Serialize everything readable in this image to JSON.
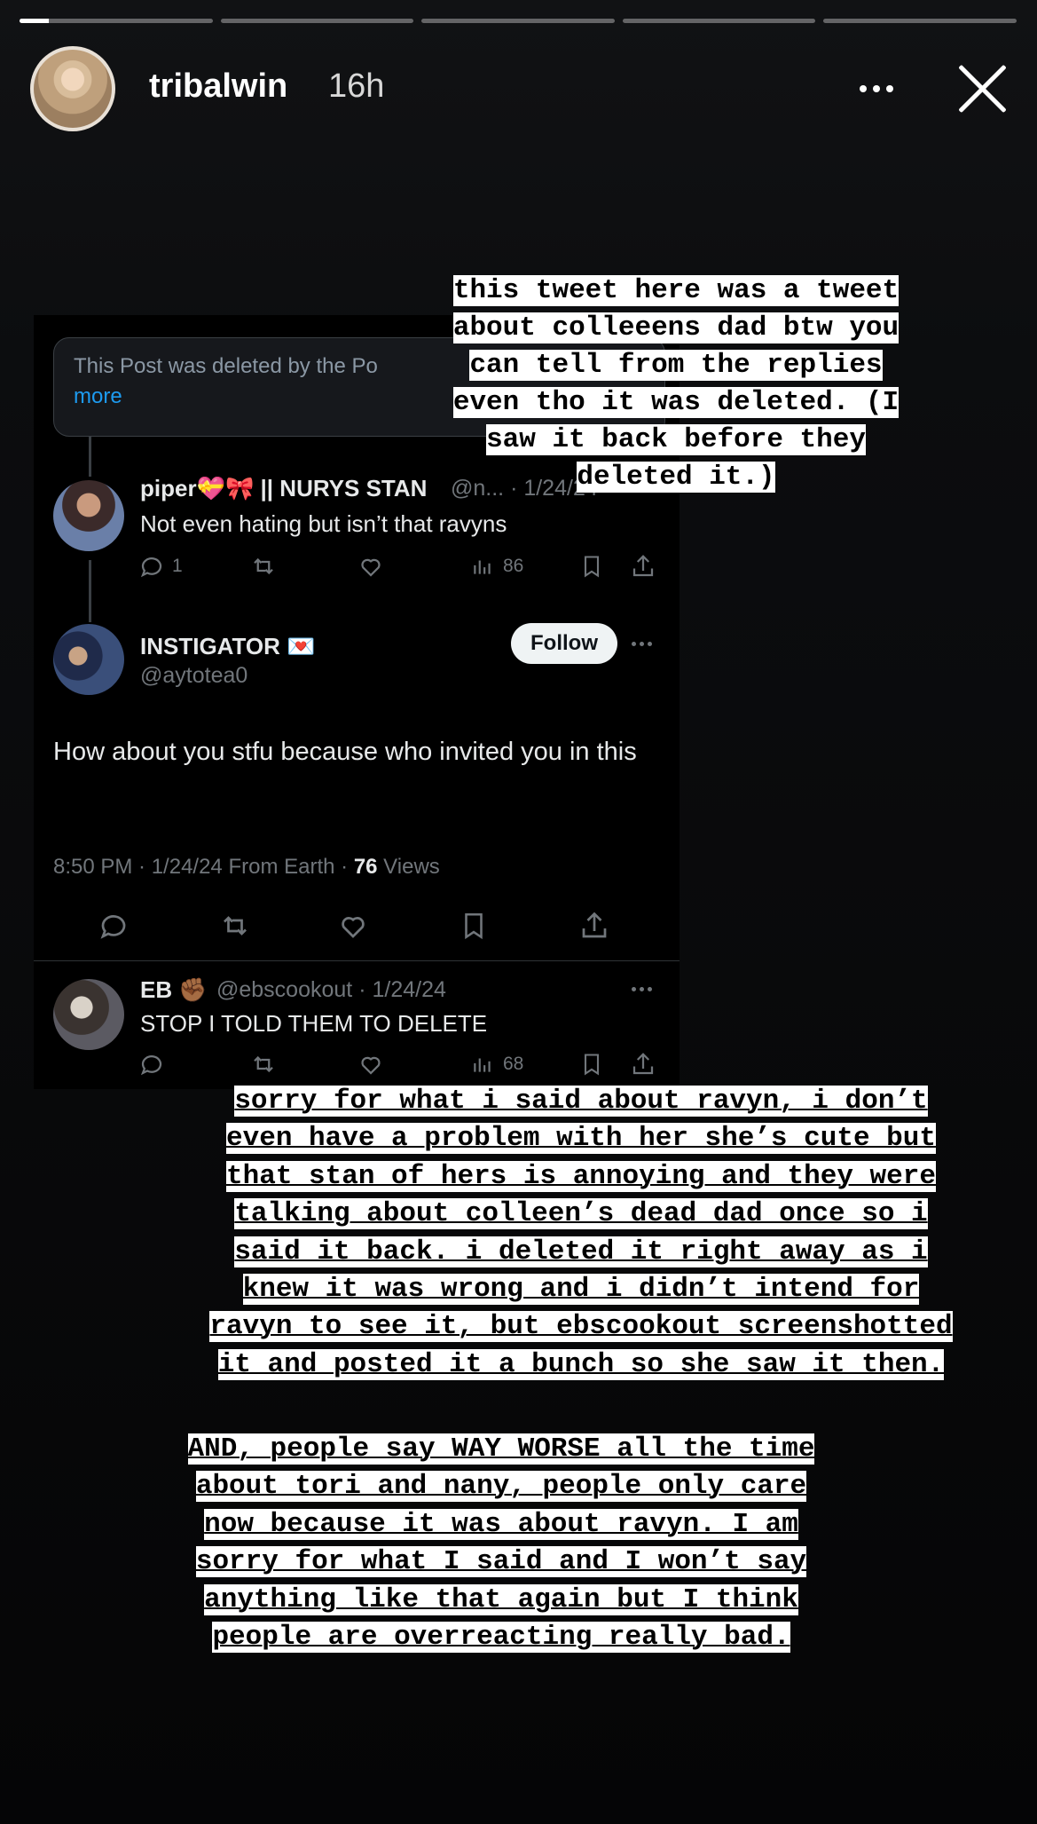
{
  "story": {
    "username": "tribalwin",
    "time": "16h",
    "progress": [
      1,
      0,
      0,
      0,
      0
    ],
    "segment_fill": [
      0.15,
      0,
      0,
      0,
      0
    ]
  },
  "screenshot": {
    "deleted_notice": "This Post was deleted by the Po",
    "deleted_more": "more",
    "reply1": {
      "name": "piper💝🎀 || NURYS STAN",
      "handle": "@n... · 1/24/24",
      "text": "Not even hating but isn’t that ravyns",
      "replies": "1",
      "views": "86"
    },
    "main": {
      "name": "INSTIGATOR 💌",
      "handle": "@aytotea0",
      "follow": "Follow",
      "text": "How about you stfu because who  invited you in this",
      "meta_time": "8:50 PM · 1/24/24 From Earth · ",
      "meta_views_num": "76",
      "meta_views_label": " Views"
    },
    "reply2": {
      "name": "EB ✊🏾",
      "handle": "@ebscookout · 1/24/24",
      "text": "STOP I TOLD THEM TO DELETE",
      "views": "68"
    }
  },
  "captions": {
    "top": [
      "this tweet here was a tweet",
      "about colleeens dad btw you",
      "can tell from the replies",
      "even tho it was deleted. (I",
      "saw it back before they",
      "deleted it.)"
    ],
    "middle": [
      "sorry for what i said about ravyn, i don’t",
      "even have a problem with her she’s cute but",
      "that stan of hers is annoying and they were",
      "talking about colleen’s dead dad once so i",
      "said it back. i deleted it right away as i",
      "knew it was wrong and i didn’t intend for",
      "ravyn to see it, but ebscookout screenshotted",
      "it and posted it a bunch so she saw it then."
    ],
    "bottom": [
      "AND, people say WAY WORSE all the time",
      "about tori and nany, people only care",
      "now because it was about ravyn. I am",
      "sorry for what I said and I won’t say",
      "anything like that again but I think",
      "people are overreacting really bad."
    ]
  },
  "colors": {
    "background": "#0a0b0c",
    "tweet_bg": "#000000",
    "link_blue": "#1d9bf0",
    "muted_gray": "#71767b",
    "caption_bg": "#ffffff"
  },
  "icons": [
    "more-icon",
    "close-icon",
    "reply-icon",
    "retweet-icon",
    "like-icon",
    "views-icon",
    "bookmark-icon",
    "share-icon"
  ]
}
